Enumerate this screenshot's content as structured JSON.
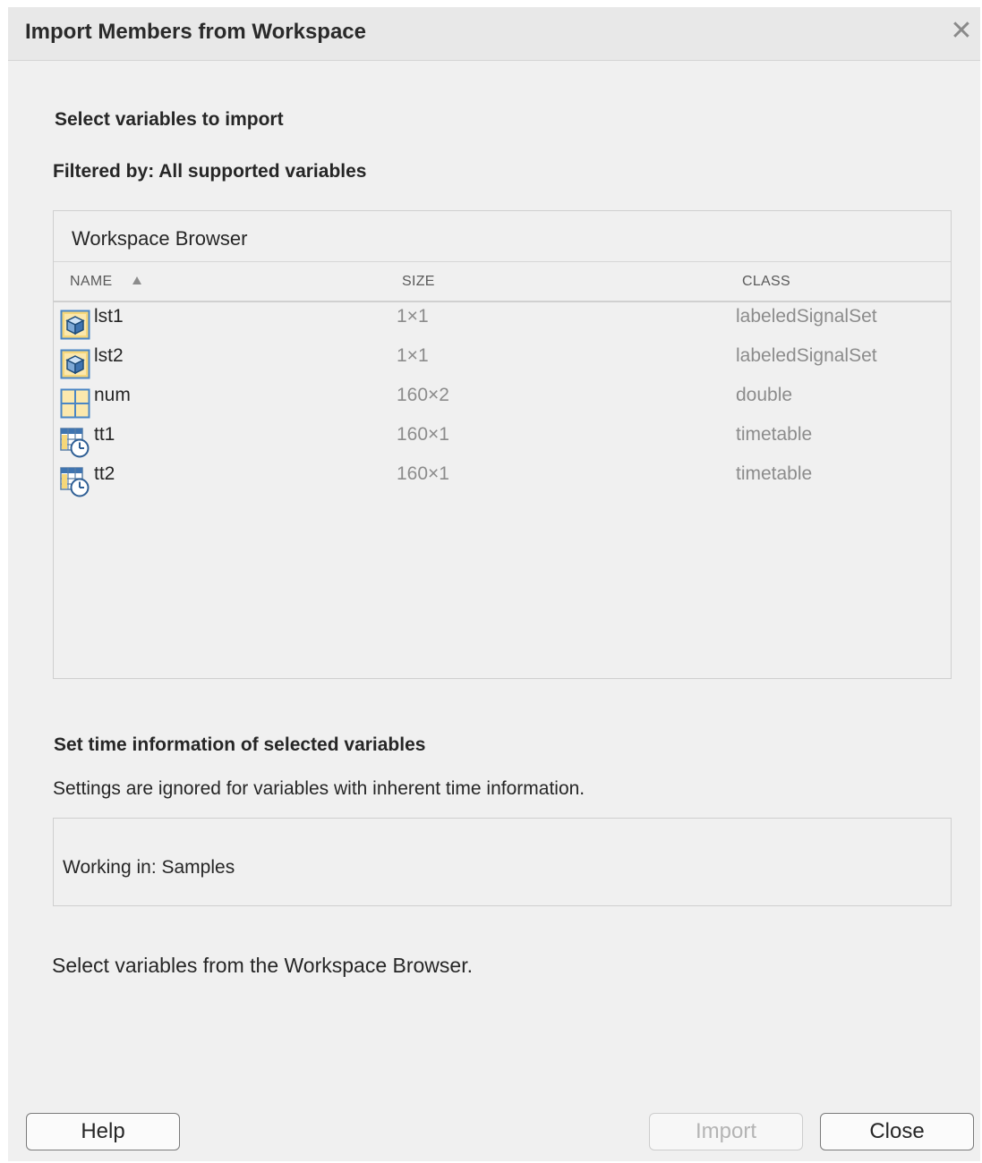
{
  "dialog": {
    "title": "Import Members from Workspace",
    "close_glyph": "✕"
  },
  "select_section": {
    "heading": "Select variables to import",
    "filter_text": "Filtered by: All supported variables"
  },
  "browser": {
    "title": "Workspace Browser",
    "columns": {
      "name": "NAME",
      "size": "SIZE",
      "class": "CLASS"
    },
    "sort_column": "name",
    "sort_direction": "ascending",
    "rows": [
      {
        "icon": "object-icon",
        "name": "lst1",
        "size": "1×1",
        "class": "labeledSignalSet"
      },
      {
        "icon": "object-icon",
        "name": "lst2",
        "size": "1×1",
        "class": "labeledSignalSet"
      },
      {
        "icon": "matrix-icon",
        "name": "num",
        "size": "160×2",
        "class": "double"
      },
      {
        "icon": "timetable-icon",
        "name": "tt1",
        "size": "160×1",
        "class": "timetable"
      },
      {
        "icon": "timetable-icon",
        "name": "tt2",
        "size": "160×1",
        "class": "timetable"
      }
    ]
  },
  "time_section": {
    "heading": "Set time information of selected variables",
    "note": "Settings are ignored for variables with inherent time information.",
    "working_in": "Working in:  Samples"
  },
  "status": {
    "message": "Select variables from the Workspace Browser."
  },
  "buttons": {
    "help": "Help",
    "import": "Import",
    "close": "Close",
    "import_enabled": false
  }
}
